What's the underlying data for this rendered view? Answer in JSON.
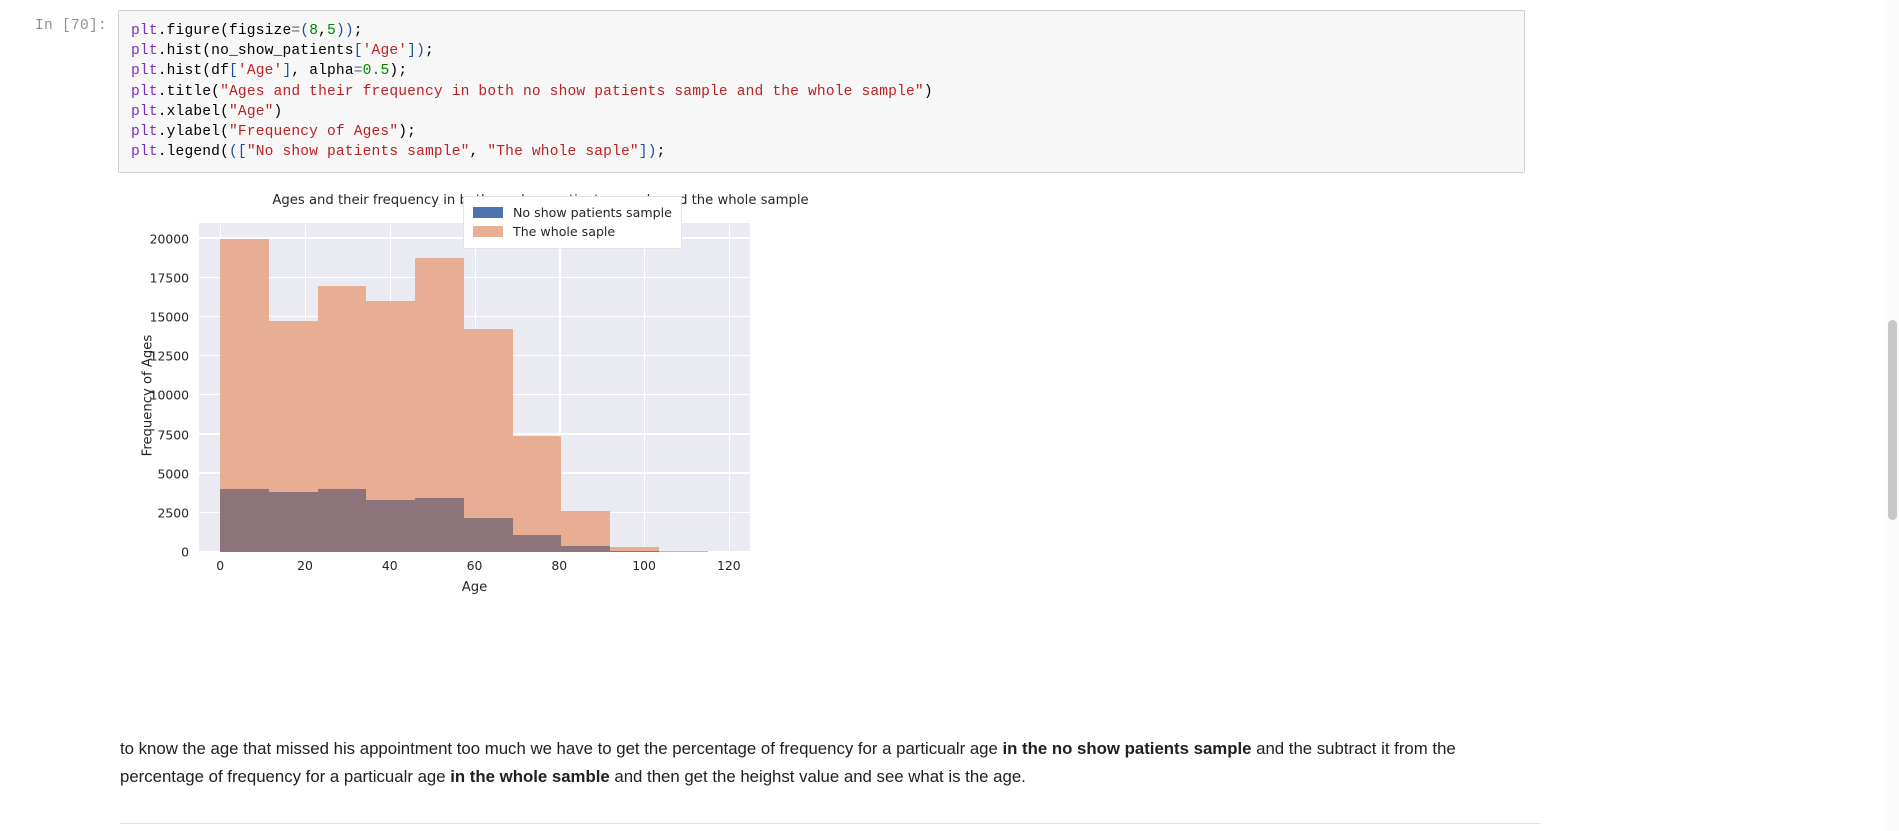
{
  "cell": {
    "prompt": "In [70]:",
    "code_lines": [
      "plt.figure(figsize=(8,5));",
      "plt.hist(no_show_patients['Age']);",
      "plt.hist(df['Age'], alpha=0.5);",
      "plt.title(\"Ages and their frequency in both no show patients sample and the whole sample\")",
      "plt.xlabel(\"Age\")",
      "plt.ylabel(\"Frequency of Ages\");",
      "plt.legend([\"No show patients sample\", \"The whole saple\"]);"
    ]
  },
  "chart_data": {
    "type": "bar",
    "title": "Ages and their frequency in both no show patients sample and the whole sample",
    "xlabel": "Age",
    "ylabel": "Frequency of Ages",
    "xlim": [
      -5,
      125
    ],
    "ylim": [
      0,
      21000
    ],
    "grid": true,
    "legend_position": "upper right",
    "xticks": [
      0,
      20,
      40,
      60,
      80,
      100,
      120
    ],
    "yticks": [
      0,
      2500,
      5000,
      7500,
      10000,
      12500,
      15000,
      17500,
      20000
    ],
    "bin_edges": [
      0,
      11.5,
      23,
      34.5,
      46,
      57.5,
      69,
      80.5,
      92,
      103.5,
      115
    ],
    "series": [
      {
        "name": "No show patients sample",
        "color": "#4c72b0",
        "values": [
          4000,
          3850,
          4050,
          3350,
          3450,
          2200,
          1100,
          380,
          60,
          10
        ]
      },
      {
        "name": "The whole saple",
        "color": "#e8ae93",
        "values": [
          19950,
          14750,
          17000,
          16000,
          18750,
          14250,
          7400,
          2600,
          300,
          50
        ]
      }
    ],
    "overlap_color": "#8d747b",
    "plot_background": "#eaeaf2",
    "grid_color": "#ffffff"
  },
  "legend": {
    "entries": [
      {
        "label": "No show patients sample",
        "swatch": "#4c72b0"
      },
      {
        "label": "The whole saple",
        "swatch": "#e8ae93"
      }
    ]
  },
  "markdown": {
    "part1": "to know the age that missed his appointment too much we have to get the percentage of frequency for a particualr age ",
    "bold1": "in the no show patients sample",
    "part2": " and the subtract it from the percentage of frequency for a particualr age ",
    "bold2": "in the whole samble",
    "part3": " and then get the heighst value and see what is the age."
  }
}
